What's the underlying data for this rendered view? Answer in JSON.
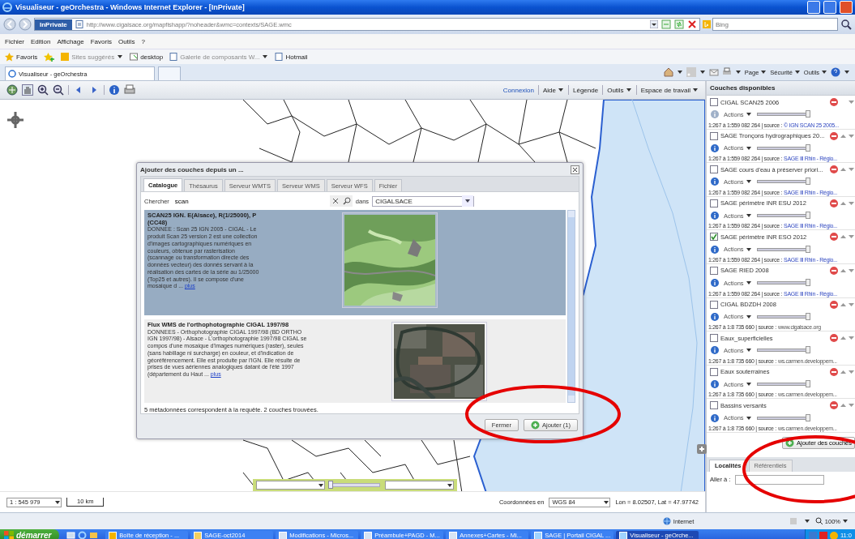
{
  "window": {
    "title": "Visualiseur - geOrchestra - Windows Internet Explorer - [InPrivate]"
  },
  "address_bar": {
    "badge": "InPrivate",
    "url": "http://www.cigalsace.org/mapfishapp/?noheader&wmc=contexts/SAGE.wmc",
    "search_placeholder": "Bing"
  },
  "menu": [
    "Fichier",
    "Edition",
    "Affichage",
    "Favoris",
    "Outils",
    "?"
  ],
  "favorites_bar": {
    "label": "Favoris",
    "items": [
      {
        "label": "Sites suggérés",
        "dropdown": true
      },
      {
        "label": "desktop",
        "dropdown": false
      },
      {
        "label": "Galerie de composants W...",
        "dropdown": true
      },
      {
        "label": "Hotmail",
        "dropdown": false
      }
    ]
  },
  "browser_tabs": [
    {
      "label": "Visualiseur - geOrchestra",
      "selected": true
    }
  ],
  "command_bar": [
    "Page",
    "Sécurité",
    "Outils"
  ],
  "app_menu": [
    {
      "label": "Connexion",
      "dropdown": false,
      "link": true
    },
    {
      "label": "Aide",
      "dropdown": true,
      "link": false
    },
    {
      "label": "Légende",
      "dropdown": false,
      "link": false
    },
    {
      "label": "Outils",
      "dropdown": true,
      "link": false
    },
    {
      "label": "Espace de travail",
      "dropdown": true,
      "link": false
    }
  ],
  "layers_panel": {
    "title": "Couches disponibles",
    "layers": [
      {
        "name": "CIGAL SCAN25 2006",
        "checked": false,
        "can_move_up": false,
        "info_enabled": false,
        "actions": "Actions",
        "level": 1,
        "scale": "1:267 à 1:559 082 264 | source :",
        "source": "© IGN SCAN 25 2005...",
        "source_link": true
      },
      {
        "name": "SAGE Tronçons hydrographiques 20...",
        "checked": false,
        "can_move_up": true,
        "info_enabled": true,
        "actions": "Actions",
        "level": 1,
        "scale": "1:267 à 1:559 082 264 | source :",
        "source": "SAGE Ill Rhin - Régio...",
        "source_link": true
      },
      {
        "name": "SAGE cours d'eau à préserver priori...",
        "checked": false,
        "can_move_up": true,
        "info_enabled": true,
        "actions": "Actions",
        "level": 1,
        "scale": "1:267 à 1:559 082 264 | source :",
        "source": "SAGE Ill Rhin - Régio...",
        "source_link": true
      },
      {
        "name": "SAGE périmètre INR ESU 2012",
        "checked": false,
        "can_move_up": true,
        "info_enabled": true,
        "actions": "Actions",
        "level": 1,
        "scale": "1:267 à 1:559 082 264 | source :",
        "source": "SAGE Ill Rhin - Régio...",
        "source_link": true
      },
      {
        "name": "SAGE périmètre INR ESO 2012",
        "checked": true,
        "can_move_up": true,
        "info_enabled": true,
        "actions": "Actions",
        "level": 1,
        "scale": "1:267 à 1:559 082 264 | source :",
        "source": "SAGE Ill Rhin - Régio...",
        "source_link": true
      },
      {
        "name": "SAGE RIED 2008",
        "checked": false,
        "can_move_up": true,
        "info_enabled": true,
        "actions": "Actions",
        "level": 1,
        "scale": "1:267 à 1:559 082 264 | source :",
        "source": "SAGE Ill Rhin - Régio...",
        "source_link": true
      },
      {
        "name": "CIGAL BDZDH 2008",
        "checked": false,
        "can_move_up": true,
        "info_enabled": true,
        "actions": "Actions",
        "level": 1,
        "scale": "1:267 à 1:8 735 660 | source :",
        "source": "www.cigalsace.org",
        "source_link": false
      },
      {
        "name": "Eaux_superficielles",
        "checked": false,
        "can_move_up": true,
        "info_enabled": true,
        "actions": "Actions",
        "level": 1,
        "scale": "1:267 à 1:8 735 660 | source :",
        "source": "ws.carmen.developpem...",
        "source_link": false
      },
      {
        "name": "Eaux souterraines",
        "checked": false,
        "can_move_up": true,
        "info_enabled": true,
        "actions": "Actions",
        "level": 1,
        "scale": "1:267 à 1:8 735 660 | source :",
        "source": "ws.carmen.developpem...",
        "source_link": false
      },
      {
        "name": "Bassins versants",
        "checked": false,
        "can_move_up": true,
        "info_enabled": true,
        "actions": "Actions",
        "level": 1,
        "scale": "1:267 à 1:8 735 660 | source :",
        "source": "ws.carmen.developpem...",
        "source_link": false
      }
    ],
    "add_button": "Ajouter des couches",
    "tabs": [
      {
        "label": "Localités",
        "selected": true
      },
      {
        "label": "Référentiels",
        "selected": false
      }
    ],
    "goto_label": "Aller à :"
  },
  "dialog": {
    "title": "Ajouter des couches depuis un ...",
    "tabs": [
      {
        "label": "Catalogue",
        "selected": true
      },
      {
        "label": "Thésaurus",
        "selected": false
      },
      {
        "label": "Serveur WMTS",
        "selected": false
      },
      {
        "label": "Serveur WMS",
        "selected": false
      },
      {
        "label": "Serveur WFS",
        "selected": false
      },
      {
        "label": "Fichier",
        "selected": false
      }
    ],
    "search_label": "Chercher",
    "search_value": "scan",
    "in_label": "dans",
    "source_value": "CIGALSACE",
    "results": [
      {
        "title": "SCAN25 IGN. E(Alsace), R(1/25000), P (CC48)",
        "description": "DONNEE : Scan 25 IGN 2005 - CIGAL - Le produit Scan 25 version 2 est une collection d'images cartographiques numériques en couleurs, obtenue par rasterisation (scannage ou transformation directe des données vecteur) des donnés servant à la réalisation des cartes de la série au 1/25000 (Top25 et autres). Il se compose d'une mosaique d ...",
        "more": "plus",
        "selected": true
      },
      {
        "title": "Flux WMS de l'orthophotographie CIGAL 1997/98",
        "description": "DONNEES - Orthophotographie CIGAL 1997/98 (BD ORTHO IGN 1997/98) - Alsace - L'orthophotographie 1997/98 CIGAL se compos d'une mosaique d'images numériques (raster), seules (sans habillage ni surcharge) en couleur, et d'indication de géoréférencement. Elle est produite par l'IGN. Elle résulte de prises de vues aériennes analogiques datant de l'été 1997 (département du Haut ...",
        "more": "plus",
        "selected": false
      }
    ],
    "count_text": "5 métadonnées correspondent à la requête. 2 couches trouvées.",
    "buttons": [
      {
        "label": "Fermer",
        "icon": false
      },
      {
        "label": "Ajouter (1)",
        "icon": true
      }
    ]
  },
  "map_widget": {
    "level": 0
  },
  "map_footer": {
    "scale": "1 : 545 979",
    "scalebar": "10 km",
    "coords_label": "Coordonnées en",
    "projection": "WGS 84",
    "position": "Lon = 8.02507, Lat = 47.97742"
  },
  "status_bar": {
    "zone": "Internet",
    "zoom": "100%"
  },
  "taskbar": {
    "start": "démarrer",
    "tasks": [
      {
        "label": "Boîte de réception - ...",
        "selected": false
      },
      {
        "label": "SAGE-oct2014",
        "selected": false
      },
      {
        "label": "Modifications - Micros...",
        "selected": false
      },
      {
        "label": "Préambule+PAGD - M...",
        "selected": false
      },
      {
        "label": "Annexes+Cartes - Mi...",
        "selected": false
      },
      {
        "label": "SAGE | Portail CIGAL ...",
        "selected": false
      },
      {
        "label": "Visualiseur - geOrche...",
        "selected": true
      }
    ],
    "clock": "11:0"
  }
}
